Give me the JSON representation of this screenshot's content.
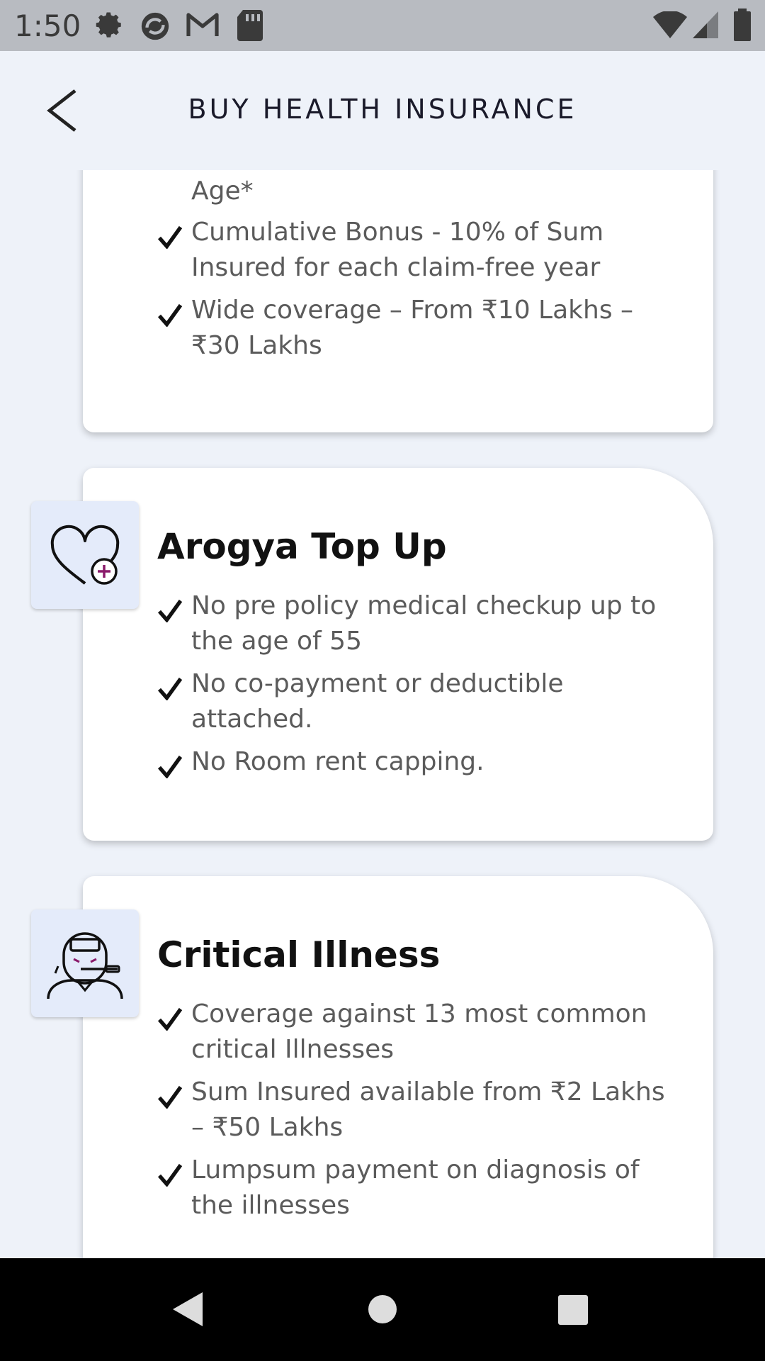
{
  "status_bar": {
    "time": "1:50",
    "icons": [
      "settings-icon",
      "sync-app-icon",
      "gmail-icon",
      "sd-card-icon"
    ],
    "right_icons": [
      "wifi-icon",
      "cell-signal-icon",
      "battery-icon"
    ]
  },
  "header": {
    "title": "BUY HEALTH INSURANCE",
    "back_icon": "chevron-left-icon"
  },
  "cards": [
    {
      "title": "",
      "features": [
        "Age*",
        "Cumulative Bonus - 10% of Sum Insured for each claim-free year",
        "Wide coverage – From ₹10 Lakhs – ₹30 Lakhs"
      ]
    },
    {
      "title": "Arogya Top Up",
      "icon": "heart-plus-icon",
      "features": [
        "No pre policy medical checkup up to the age of 55",
        "No co-payment or deductible attached.",
        "No Room rent capping."
      ]
    },
    {
      "title": "Critical Illness",
      "icon": "sick-person-icon",
      "features": [
        "Coverage against 13 most common critical Illnesses",
        "Sum Insured available from ₹2 Lakhs – ₹50 Lakhs",
        "Lumpsum payment on diagnosis of the illnesses"
      ]
    }
  ],
  "nav_bar": {
    "icons": [
      "back-triangle-icon",
      "home-circle-icon",
      "recents-square-icon"
    ]
  }
}
